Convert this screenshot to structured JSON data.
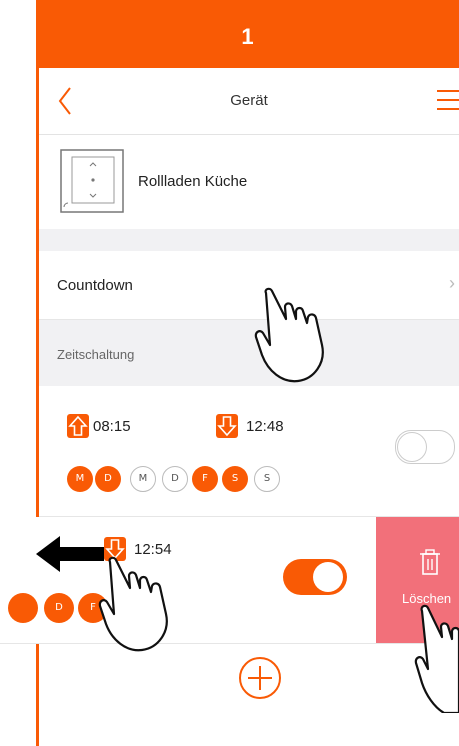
{
  "step": {
    "number": "1"
  },
  "header": {
    "title": "Gerät",
    "back_icon": "chevron-left-icon",
    "menu_icon": "hamburger-menu-icon"
  },
  "device": {
    "name": "Rollladen Küche",
    "icon": "shutter-switch-icon"
  },
  "countdown": {
    "label": "Countdown",
    "chevron": "›"
  },
  "section": {
    "label": "Zeitschaltung"
  },
  "schedule1": {
    "up_time": "08:15",
    "down_time": "12:48",
    "days": [
      {
        "label": "M",
        "active": true
      },
      {
        "label": "D",
        "active": true
      },
      {
        "label": "M",
        "active": false
      },
      {
        "label": "D",
        "active": false
      },
      {
        "label": "F",
        "active": true
      },
      {
        "label": "S",
        "active": true
      },
      {
        "label": "S",
        "active": false
      }
    ],
    "enabled": false
  },
  "schedule2": {
    "down_time": "12:54",
    "days": [
      {
        "label": "D",
        "active": true
      },
      {
        "label": "F",
        "active": true
      }
    ],
    "enabled": true
  },
  "delete": {
    "label": "Löschen"
  },
  "colors": {
    "accent": "#f95a05",
    "delete_bg": "#f2707a",
    "band": "#f1f1f3"
  }
}
